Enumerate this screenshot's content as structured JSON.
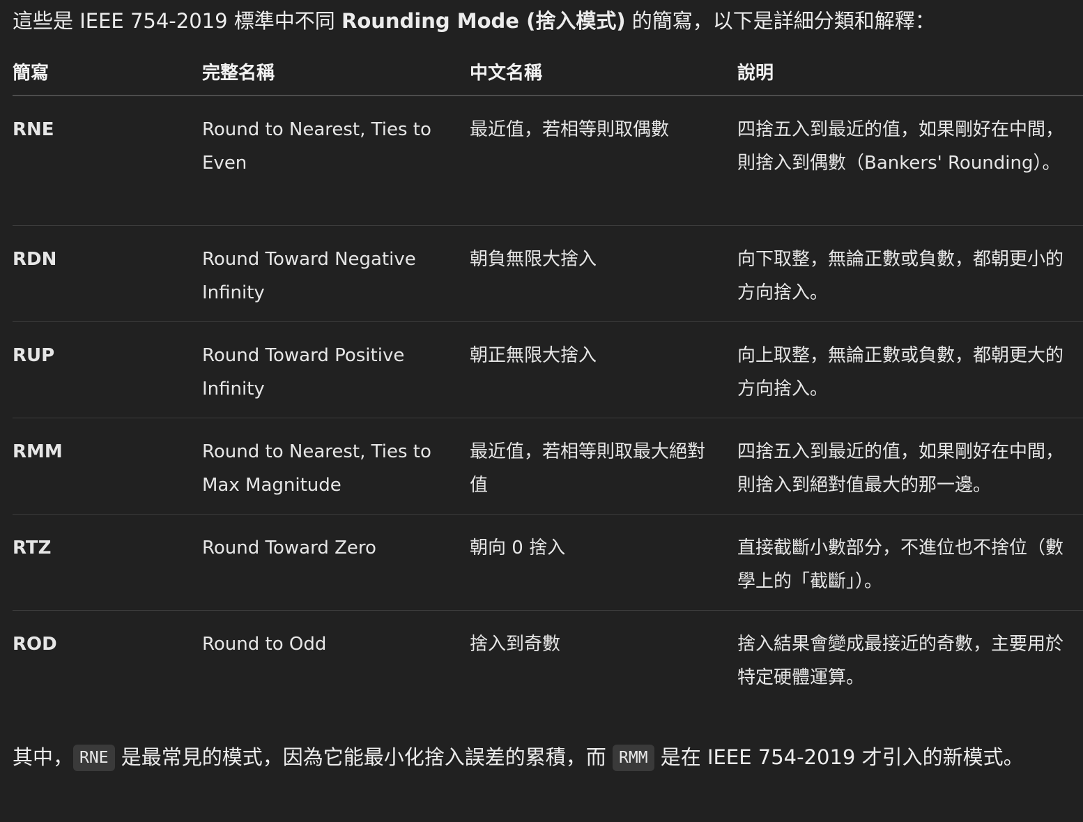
{
  "intro": {
    "before": "這些是 IEEE 754-2019 標準中不同 ",
    "bold": "Rounding Mode (捨入模式)",
    "after": " 的簡寫，以下是詳細分類和解釋："
  },
  "table": {
    "headers": [
      "簡寫",
      "完整名稱",
      "中文名稱",
      "說明"
    ],
    "rows": [
      {
        "abbr": "RNE",
        "full_name": "Round to Nearest, Ties to Even",
        "chinese_name": "最近值，若相等則取偶數",
        "description": "四捨五入到最近的值，如果剛好在中間，則捨入到偶數（Bankers' Rounding）。"
      },
      {
        "abbr": "RDN",
        "full_name": "Round Toward Negative Infinity",
        "chinese_name": "朝負無限大捨入",
        "description": "向下取整，無論正數或負數，都朝更小的方向捨入。"
      },
      {
        "abbr": "RUP",
        "full_name": "Round Toward Positive Infinity",
        "chinese_name": "朝正無限大捨入",
        "description": "向上取整，無論正數或負數，都朝更大的方向捨入。"
      },
      {
        "abbr": "RMM",
        "full_name": "Round to Nearest, Ties to Max Magnitude",
        "chinese_name": "最近值，若相等則取最大絕對值",
        "description": "四捨五入到最近的值，如果剛好在中間，則捨入到絕對值最大的那一邊。"
      },
      {
        "abbr": "RTZ",
        "full_name": "Round Toward Zero",
        "chinese_name": "朝向 0 捨入",
        "description": "直接截斷小數部分，不進位也不捨位（數學上的「截斷」）。"
      },
      {
        "abbr": "ROD",
        "full_name": "Round to Odd",
        "chinese_name": "捨入到奇數",
        "description": "捨入結果會變成最接近的奇數，主要用於特定硬體運算。"
      }
    ]
  },
  "outro": {
    "part1": "其中，",
    "code1": "RNE",
    "part2": " 是最常見的模式，因為它能最小化捨入誤差的累積，而 ",
    "code2": "RMM",
    "part3": " 是在 IEEE 754-2019 才引入的新模式。"
  }
}
